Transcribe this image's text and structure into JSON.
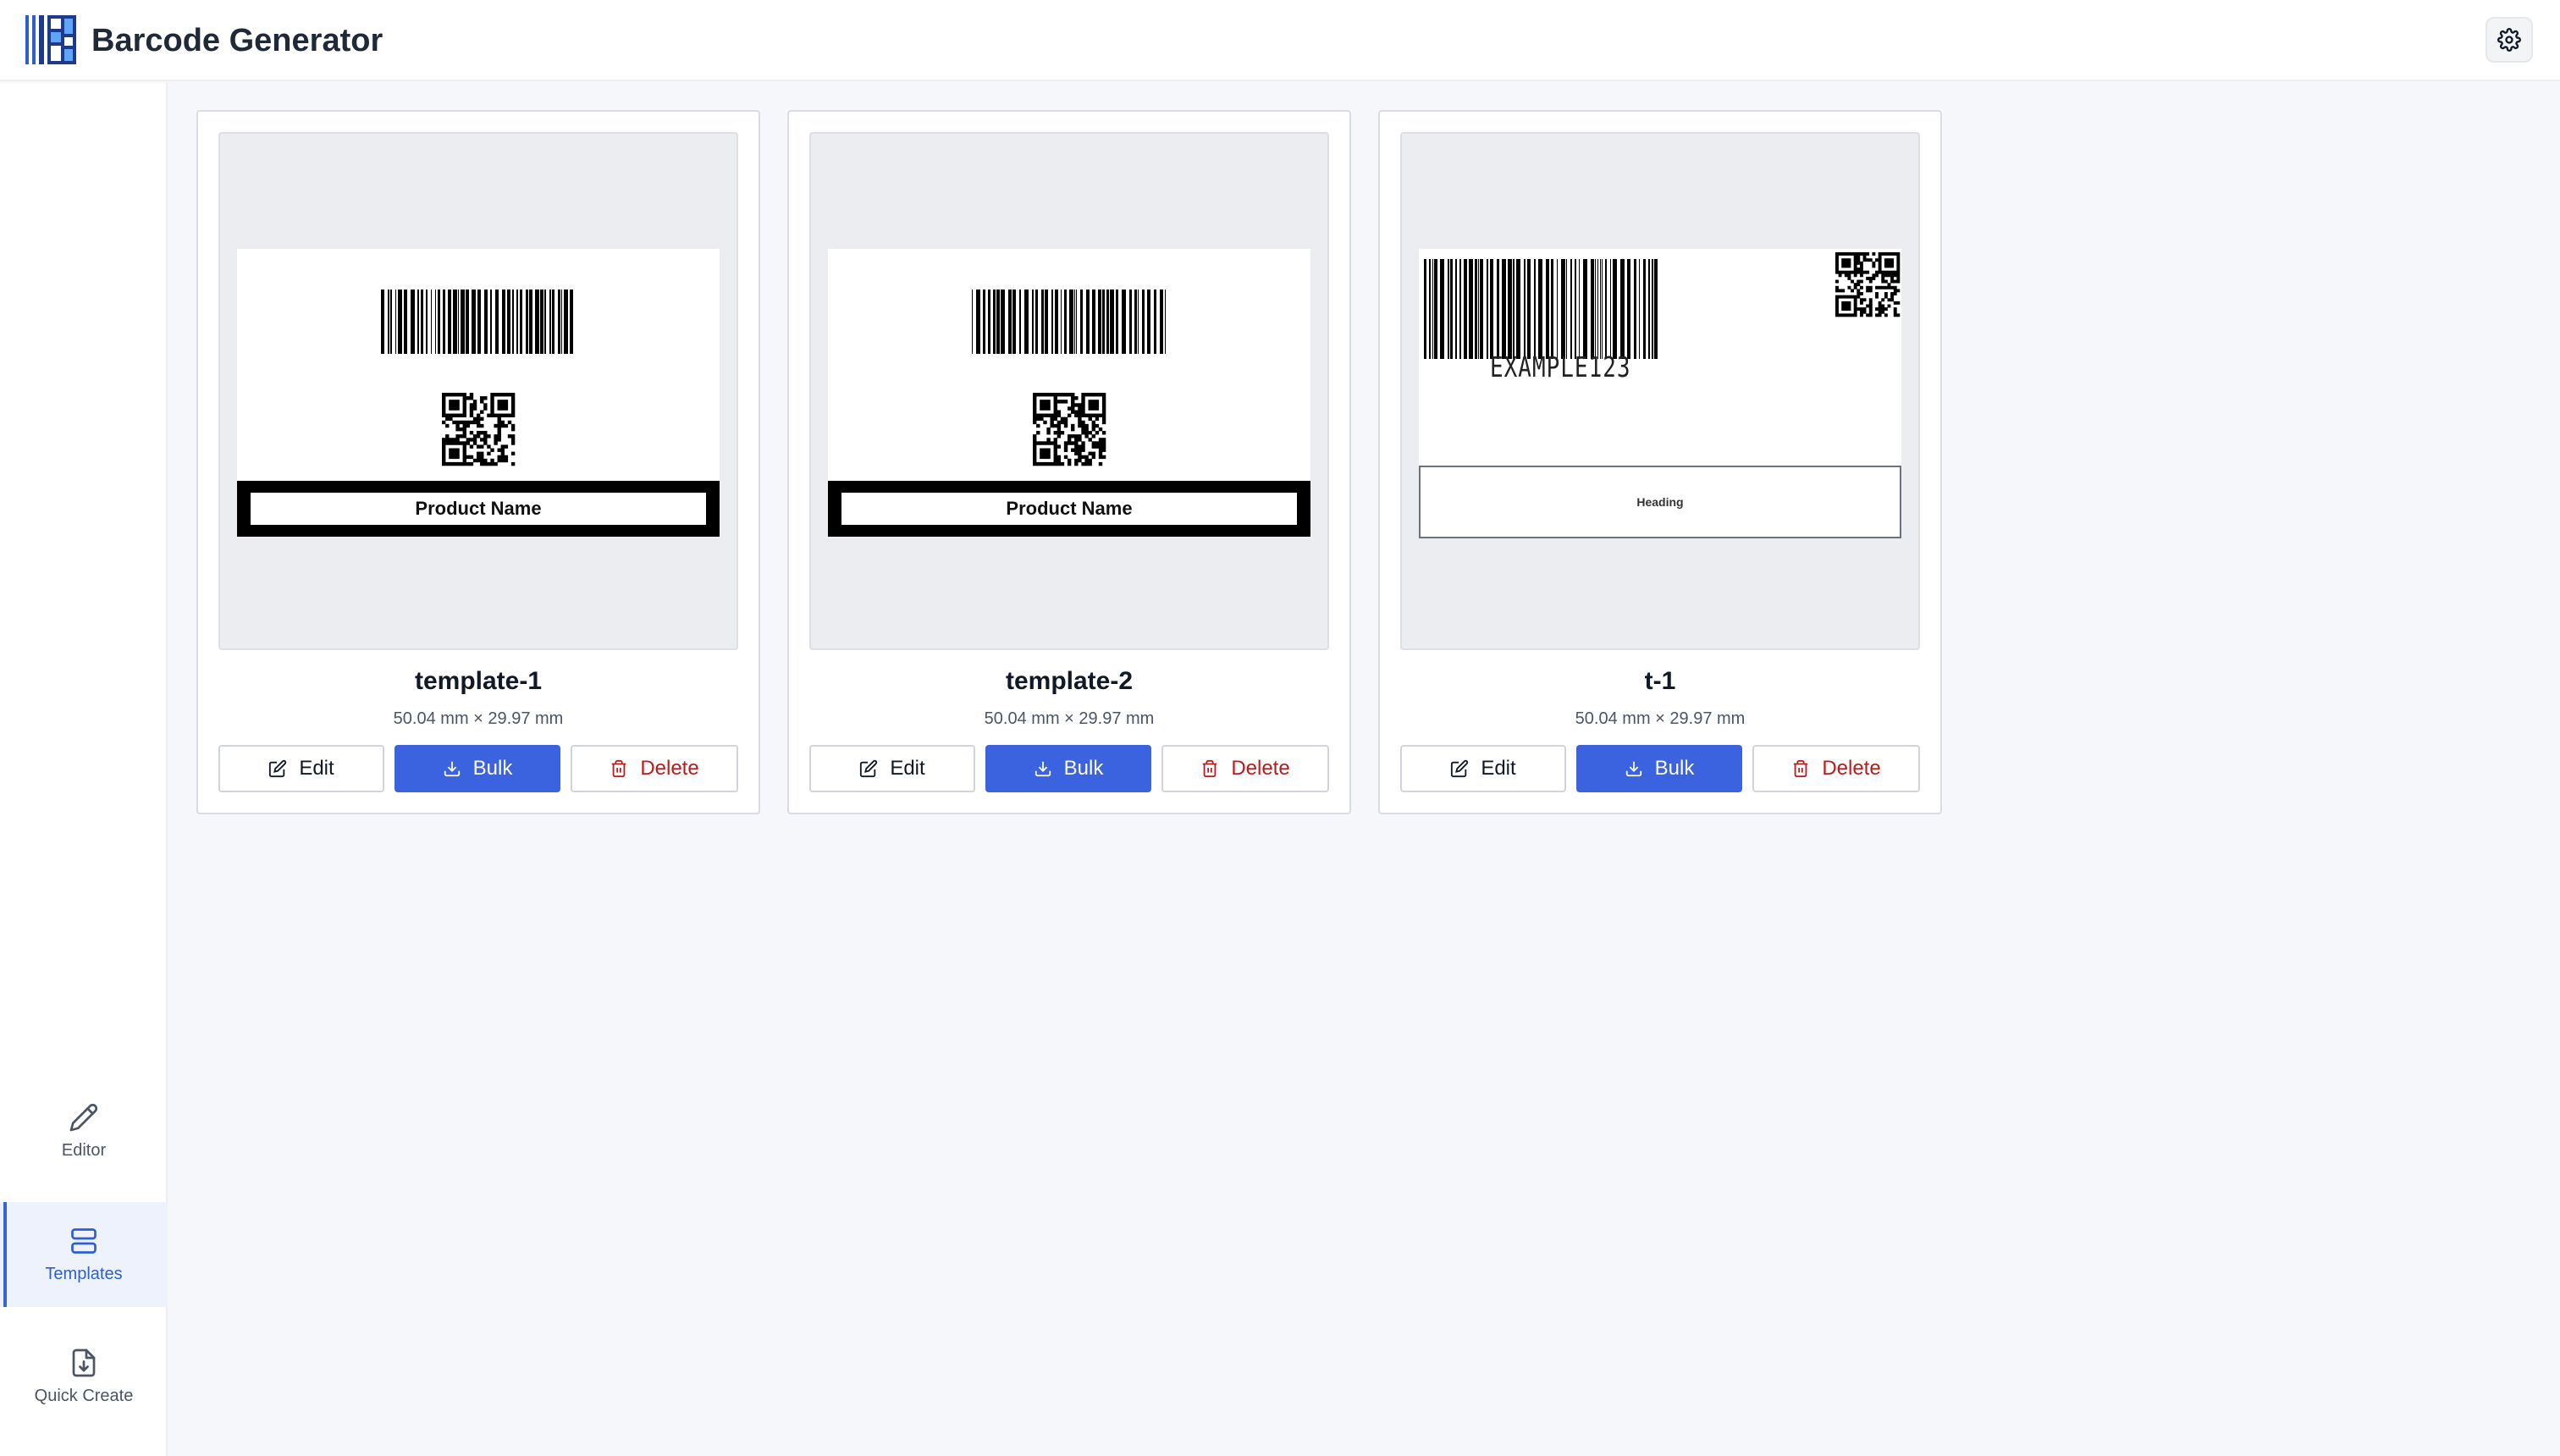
{
  "app": {
    "title": "Barcode Generator"
  },
  "icons": {
    "logo": "barcode-logo-icon",
    "settings": "gear-icon",
    "editor": "pencil-icon",
    "templates": "stack-icon",
    "quick_create": "file-download-icon",
    "edit": "edit-icon",
    "bulk": "download-icon",
    "delete": "trash-icon"
  },
  "colors": {
    "accent": "#3b63e0",
    "danger": "#b91c1c",
    "active_nav_bg": "#eef2fd"
  },
  "sidebar": {
    "items": [
      {
        "label": "Editor",
        "active": false
      },
      {
        "label": "Templates",
        "active": true
      },
      {
        "label": "Quick Create",
        "active": false
      }
    ]
  },
  "templates": [
    {
      "name": "template-1",
      "dims": "50.04 mm × 29.97 mm",
      "product_label": "Product Name"
    },
    {
      "name": "template-2",
      "dims": "50.04 mm × 29.97 mm",
      "product_label": "Product Name"
    },
    {
      "name": "t-1",
      "dims": "50.04 mm × 29.97 mm",
      "code_text": "EXAMPLE123",
      "heading_label": "Heading"
    }
  ],
  "buttons": {
    "edit": "Edit",
    "bulk": "Bulk",
    "delete": "Delete"
  }
}
